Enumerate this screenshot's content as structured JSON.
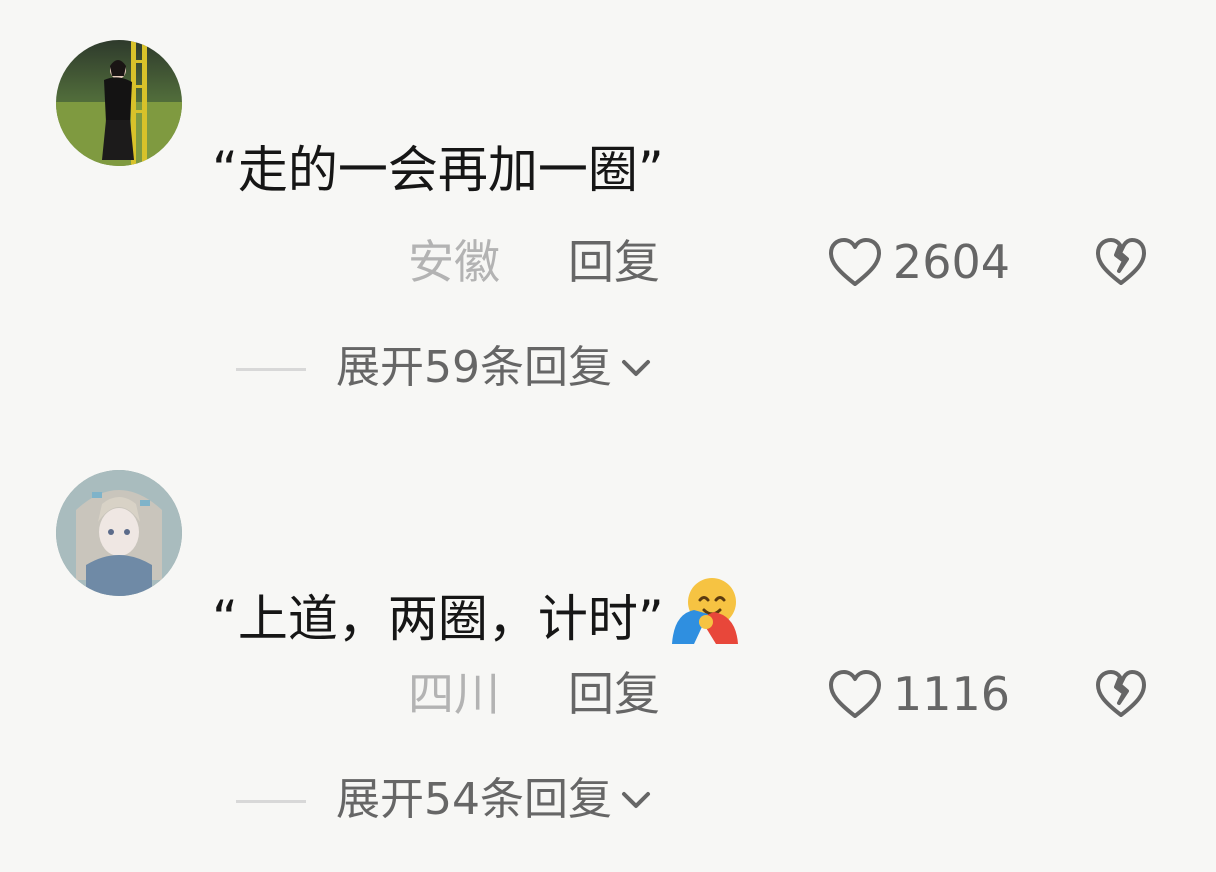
{
  "comments": [
    {
      "text": "“走的一会再加一圈”",
      "location": "安徽",
      "reply_label": "回复",
      "likes": "2604",
      "expand_label": "展开59条回复",
      "has_emoji": false
    },
    {
      "text": "“上道，两圈，计时”",
      "location": "四川",
      "reply_label": "回复",
      "likes": "1116",
      "expand_label": "展开54条回复",
      "has_emoji": true,
      "emoji": "hugging-face-emoji"
    }
  ],
  "icons": {
    "like": "heart-outline-icon",
    "dislike": "broken-heart-icon",
    "expand": "chevron-down-icon"
  },
  "colors": {
    "background": "#f7f7f5",
    "comment_text": "#161616",
    "location_text": "#b3b3b3",
    "meta_text": "#666666"
  }
}
